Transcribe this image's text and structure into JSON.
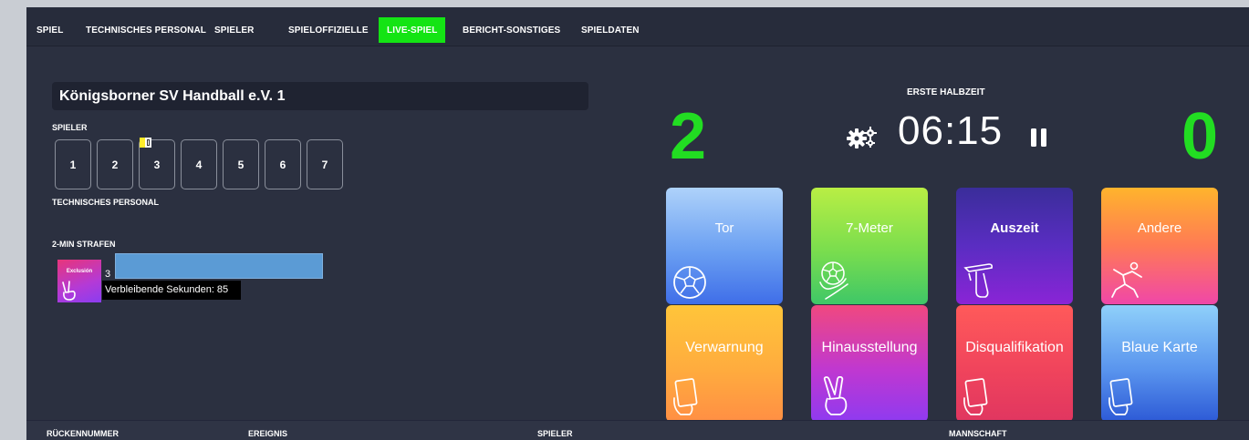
{
  "nav": {
    "tabs": [
      {
        "label": "SPIEL"
      },
      {
        "label": "TECHNISCHES PERSONAL"
      },
      {
        "label": "SPIELER"
      },
      {
        "label": "SPIELOFFIZIELLE"
      },
      {
        "label": "LIVE-SPIEL"
      },
      {
        "label": "BERICHT-SONSTIGES"
      },
      {
        "label": "SPIELDATEN"
      }
    ],
    "active_tab": "LIVE-SPIEL",
    "active_color": "#14e414"
  },
  "team": {
    "name": "Königsborner SV Handball e.V. 1",
    "players_label": "SPIELER",
    "players": [
      "1",
      "2",
      "3",
      "4",
      "5",
      "6",
      "7"
    ],
    "staff_label": "TECHNISCHES PERSONAL",
    "penalties_label": "2-MIN STRAFEN",
    "penalty": {
      "icon_label": "Exclusión",
      "player_number": "3",
      "remaining_text": "Verbleibende Sekunden: 85"
    }
  },
  "game": {
    "period": "ERSTE HALBZEIT",
    "score_home": "2",
    "score_away": "0",
    "clock": "06:15",
    "score_color": "#22dd22"
  },
  "actions": {
    "goal": "Tor",
    "seven_meter": "7-Meter",
    "timeout": "Auszeit",
    "other": "Andere",
    "warning": "Verwarnung",
    "suspension": "Hinausstellung",
    "disqualification": "Disqualifikation",
    "blue_card": "Blaue Karte"
  },
  "table": {
    "columns": [
      "RÜCKENNUMMER",
      "EREIGNIS",
      "SPIELER",
      "MANNSCHAFT"
    ]
  }
}
